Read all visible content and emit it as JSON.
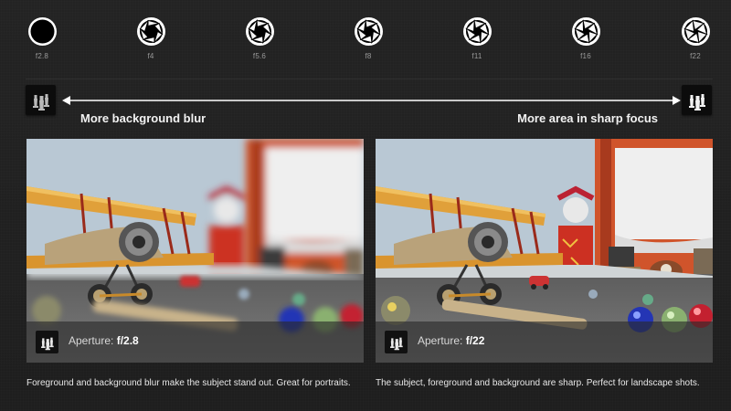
{
  "apertures": [
    {
      "label": "f2.8",
      "icon": "aperture-wide-open-icon"
    },
    {
      "label": "f4",
      "icon": "aperture-icon"
    },
    {
      "label": "f5.6",
      "icon": "aperture-icon"
    },
    {
      "label": "f8",
      "icon": "aperture-icon"
    },
    {
      "label": "f11",
      "icon": "aperture-icon"
    },
    {
      "label": "f16",
      "icon": "aperture-icon"
    },
    {
      "label": "f22",
      "icon": "aperture-icon"
    }
  ],
  "scale": {
    "left_text": "More background blur",
    "right_text": "More area in sharp focus",
    "left_icon": "chess-pieces-blurred-icon",
    "right_icon": "chess-pieces-sharp-icon"
  },
  "panels": [
    {
      "caption_prefix": "Aperture: ",
      "caption_value": "f/2.8",
      "description": "Foreground and background blur make the subject stand out. Great for portraits.",
      "focus": "shallow"
    },
    {
      "caption_prefix": "Aperture: ",
      "caption_value": "f/22",
      "description": "The subject, foreground and background are sharp. Perfect for landscape shots.",
      "focus": "deep"
    }
  ],
  "colors": {
    "background": "#222222",
    "text": "#ffffff",
    "muted_text": "#9a9a9a",
    "wall": "#b7c7d3",
    "table": "#6f6f6f",
    "headboard": "#c7542c"
  }
}
